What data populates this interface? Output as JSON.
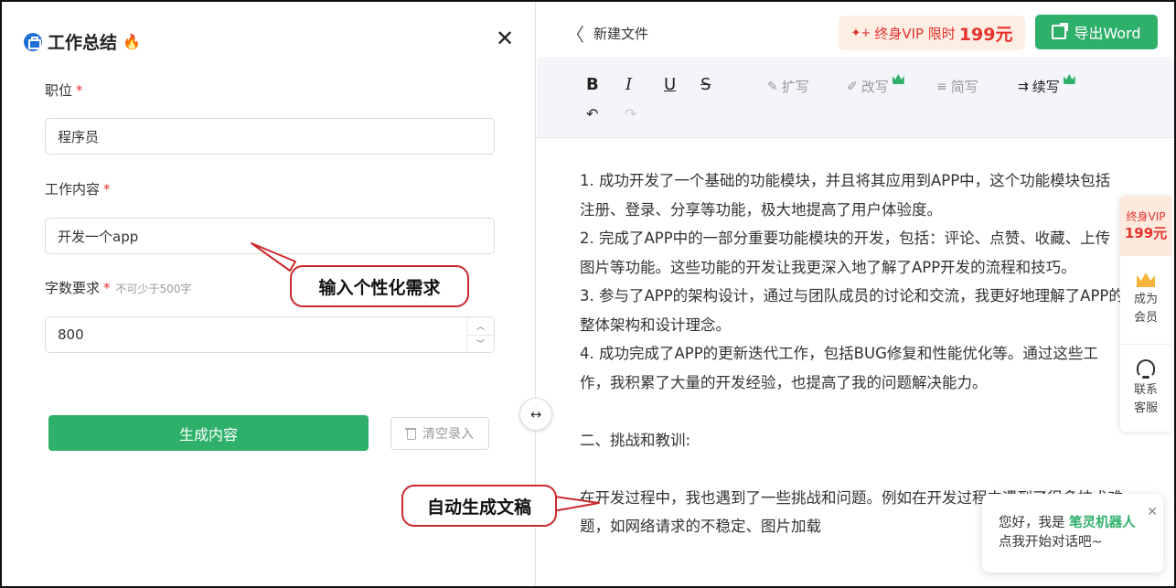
{
  "panel": {
    "title": "工作总结",
    "close_glyph": "✕",
    "fire_glyph": "🔥",
    "fields": {
      "position": {
        "label": "职位",
        "required": "*",
        "value": "程序员"
      },
      "content": {
        "label": "工作内容",
        "required": "*",
        "value": "开发一个app"
      },
      "word_count": {
        "label": "字数要求",
        "required": "*",
        "hint": "不可少于500字",
        "value": "800"
      }
    },
    "stepper_up": "︿",
    "stepper_down": "﹀",
    "generate_label": "生成内容",
    "clear_label": "清空录入"
  },
  "callouts": {
    "input_note": "输入个性化需求",
    "auto_note": "自动生成文稿"
  },
  "handle_glyph": "↔",
  "editor": {
    "back_glyph": "〈",
    "doc_title": "新建文件",
    "vip_promo": {
      "spark": "✦+",
      "text": "终身VIP 限时",
      "price": "199元"
    },
    "export_label": "导出Word",
    "toolbar": {
      "bold": "B",
      "italic": "I",
      "underline": "U",
      "strike": "S",
      "expand": "扩写",
      "rewrite": "改写",
      "simplify": "简写",
      "continue": "续写",
      "expand_glyph": "✎",
      "rewrite_glyph": "✐",
      "simplify_glyph": "≡",
      "continue_glyph": "⇉",
      "undo": "↶",
      "redo": "↷"
    },
    "paragraphs": [
      "1. 成功开发了一个基础的功能模块，并且将其应用到APP中，这个功能模块包括注册、登录、分享等功能，极大地提高了用户体验度。",
      "2. 完成了APP中的一部分重要功能模块的开发，包括：评论、点赞、收藏、上传图片等功能。这些功能的开发让我更深入地了解了APP开发的流程和技巧。",
      "3. 参与了APP的架构设计，通过与团队成员的讨论和交流，我更好地理解了APP的整体架构和设计理念。",
      "4. 成功完成了APP的更新迭代工作，包括BUG修复和性能优化等。通过这些工作，我积累了大量的开发经验，也提高了我的问题解决能力。",
      "",
      "二、挑战和教训:",
      "",
      "在开发过程中，我也遇到了一些挑战和问题。例如在开发过程中遇到了很多技术难题，如网络请求的不稳定、图片加载"
    ]
  },
  "float_bar": {
    "vip_label": "终身VIP",
    "vip_price": "199元",
    "member_line1": "成为",
    "member_line2": "会员",
    "service_line1": "联系",
    "service_line2": "客服"
  },
  "chat": {
    "greeting": "您好，我是",
    "bot_name": "笔灵机器人",
    "prompt": "点我开始对话吧~",
    "close_glyph": "✕"
  },
  "colors": {
    "brand_green": "#2eb06b",
    "accent_red": "#e5322d",
    "callout_border": "#c9292b"
  }
}
